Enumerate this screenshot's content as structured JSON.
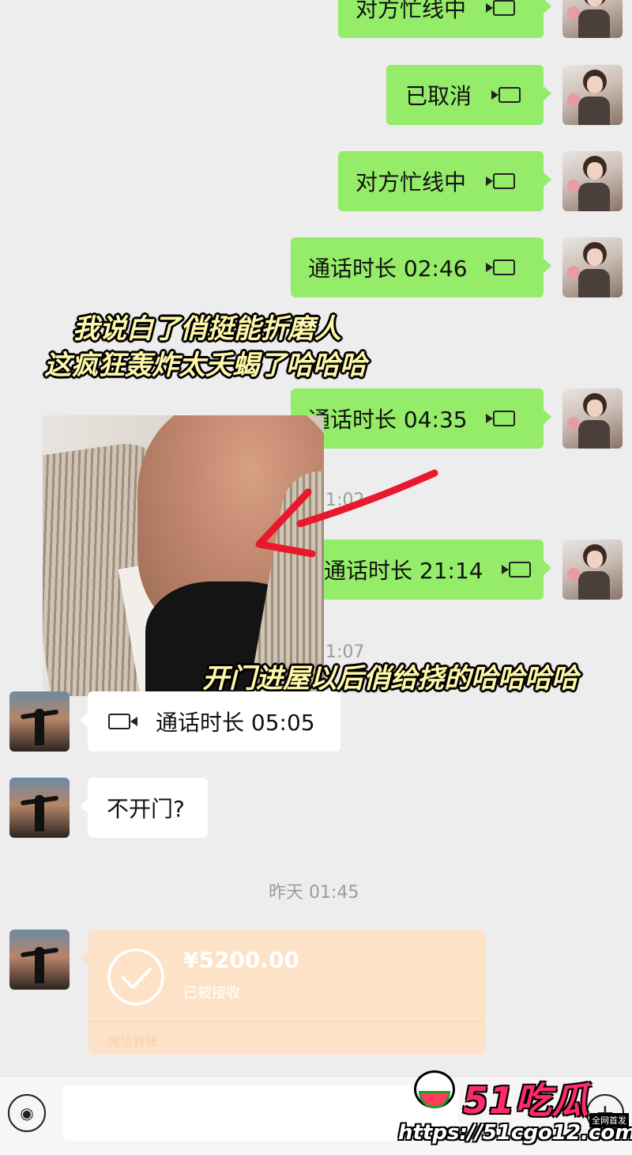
{
  "messages": {
    "sent_1": "对方忙线中",
    "sent_2": "已取消",
    "sent_3": "对方忙线中",
    "sent_4": "通话时长 02:46",
    "sent_5": "通话时长 04:35",
    "sent_6": "通话时长 21:14",
    "recv_1": "通话时长 05:05",
    "recv_2": "不开门?"
  },
  "timestamps": {
    "partial_1": "1:02",
    "partial_2": "1:07",
    "yesterday": "昨天 01:45"
  },
  "captions": {
    "line_1": "我说白了俏挺能折磨人",
    "line_2": "这疯狂轰炸太夭蝎了哈哈哈",
    "line_3": "开门进屋以后俏给挠的哈哈哈哈"
  },
  "transfer": {
    "amount": "¥5200.00",
    "status": "已被接收",
    "footer": "微信转账"
  },
  "watermark": {
    "brand": "51吃瓜",
    "badge": "全网首发",
    "url": "https://51cgo12.com"
  },
  "icons": {
    "video_call": "video-camera-icon",
    "voice": "voice-icon",
    "plus": "plus-icon",
    "check": "check-circle-icon"
  },
  "colors": {
    "sent_bubble": "#95ec69",
    "received_bubble": "#ffffff",
    "transfer_bubble": "#fde2c8",
    "background": "#ededed",
    "caption_text": "#fff7a8"
  }
}
